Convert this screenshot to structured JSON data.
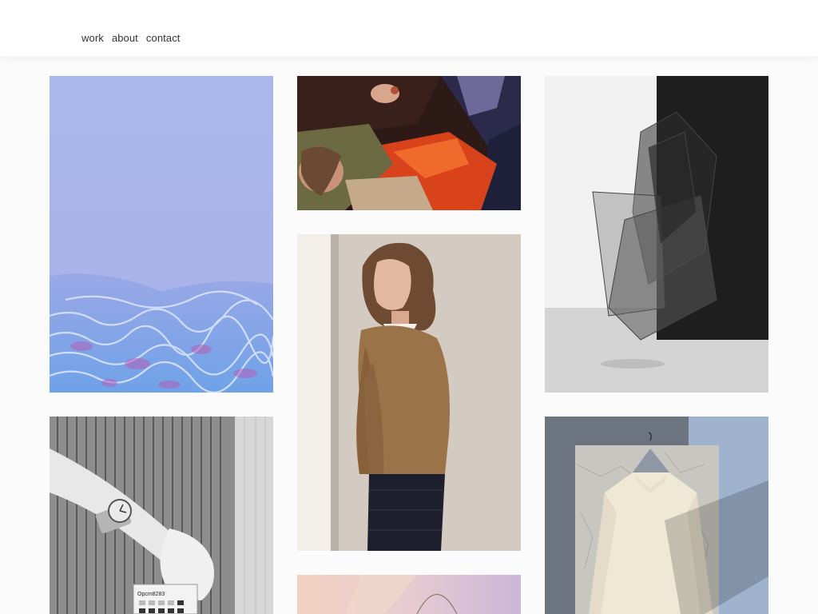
{
  "nav": {
    "items": [
      {
        "label": "work"
      },
      {
        "label": "about"
      },
      {
        "label": "contact"
      }
    ]
  },
  "gallery": {
    "tiles": [
      {
        "subject": "blue water surface with rippling caustics",
        "accent": "#9fb2ea"
      },
      {
        "subject": "model in orange and olive jacket lying down, dark background",
        "accent": "#d94a1f"
      },
      {
        "subject": "translucent grey plastic sculpture against black and white wall",
        "accent": "#2a2a2a"
      },
      {
        "subject": "black and white wrist with wristwatch over calculator",
        "accent": "#9a9a9a"
      },
      {
        "subject": "woman in camel jacket in profile",
        "accent": "#9b7348"
      },
      {
        "subject": "cream blouse on hanger against cracked panel",
        "accent": "#eae2cf"
      },
      {
        "subject": "pastel peach and lilac abstract",
        "accent": "#e7c9d8"
      }
    ],
    "watch_label": "Opcm8283"
  }
}
